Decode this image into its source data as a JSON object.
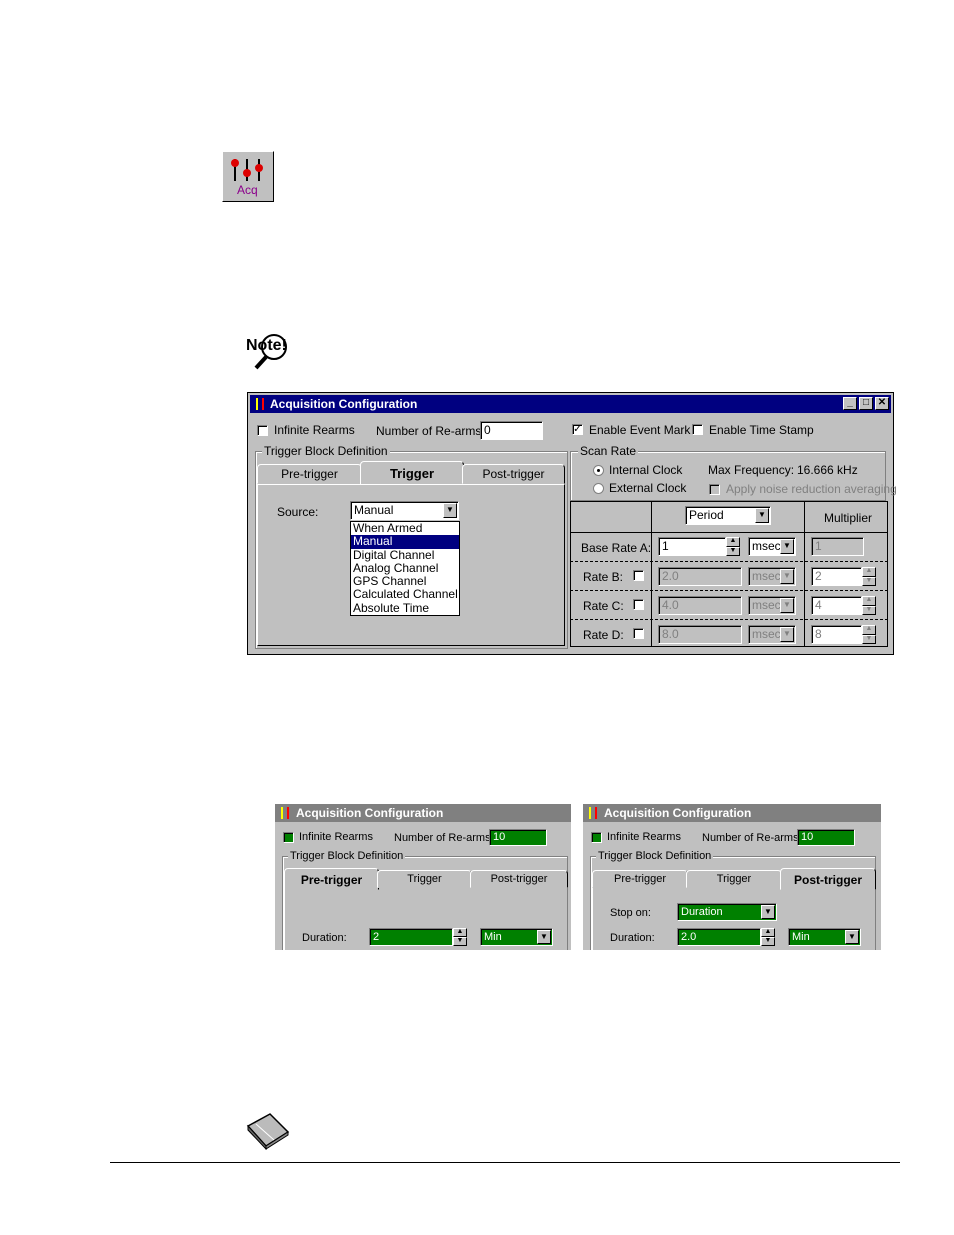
{
  "acq_icon": {
    "icon": "acq-toolbar-icon",
    "label": "Acq"
  },
  "note_icon": {
    "icon": "note-magnifier-icon",
    "label": "Note!"
  },
  "book_icon": {
    "icon": "reference-book-icon"
  },
  "main_window": {
    "title": "Acquisition Configuration",
    "infinite_rearms_label": "Infinite Rearms",
    "infinite_rearms_checked": false,
    "num_rearms_label": "Number of Re-arms:",
    "num_rearms_value": "0",
    "enable_event_mark_label": "Enable Event Mark",
    "enable_event_mark_checked": true,
    "enable_time_stamp_label": "Enable Time Stamp",
    "enable_time_stamp_checked": false,
    "trigger_block_label": "Trigger Block Definition",
    "tabs": [
      "Pre-trigger",
      "Trigger",
      "Post-trigger"
    ],
    "active_tab": "Trigger",
    "source_label": "Source:",
    "source_value": "Manual",
    "source_options": [
      "When Armed",
      "Manual",
      "Digital Channel",
      "Analog Channel",
      "GPS Channel",
      "Calculated Channel",
      "Absolute Time"
    ],
    "source_selected": "Manual",
    "scan_rate_label": "Scan Rate",
    "internal_clock_label": "Internal Clock",
    "external_clock_label": "External Clock",
    "max_freq_label": "Max Frequency:",
    "max_freq_value": "16.666 kHz",
    "noise_reduction_label": "Apply noise reduction averaging",
    "period_value": "Period",
    "multiplier_label": "Multiplier",
    "rates": [
      {
        "label": "Base Rate A:",
        "value": "1",
        "unit": "msec",
        "multiplier": "1"
      },
      {
        "label": "Rate B:",
        "value": "2.0",
        "unit": "msec",
        "multiplier": "2"
      },
      {
        "label": "Rate C:",
        "value": "4.0",
        "unit": "msec",
        "multiplier": "4"
      },
      {
        "label": "Rate D:",
        "value": "8.0",
        "unit": "msec",
        "multiplier": "8"
      }
    ]
  },
  "small_windows": [
    {
      "title": "Acquisition Configuration",
      "infinite_rearms_label": "Infinite Rearms",
      "num_rearms_label": "Number of Re-arms:",
      "num_rearms_value": "10",
      "trigger_block_label": "Trigger Block Definition",
      "tabs": [
        "Pre-trigger",
        "Trigger",
        "Post-trigger"
      ],
      "active_tab": "Pre-trigger",
      "duration_label": "Duration:",
      "duration_value": "2",
      "unit_value": "Min"
    },
    {
      "title": "Acquisition Configuration",
      "infinite_rearms_label": "Infinite Rearms",
      "num_rearms_label": "Number of Re-arms:",
      "num_rearms_value": "10",
      "trigger_block_label": "Trigger Block Definition",
      "tabs": [
        "Pre-trigger",
        "Trigger",
        "Post-trigger"
      ],
      "active_tab": "Post-trigger",
      "stop_on_label": "Stop on:",
      "stop_on_value": "Duration",
      "duration_label": "Duration:",
      "duration_value": "2.0",
      "unit_value": "Min"
    }
  ],
  "colors": {
    "title_bar": "#000080",
    "window_face": "#c0c0c0",
    "green_field": "#008000"
  }
}
